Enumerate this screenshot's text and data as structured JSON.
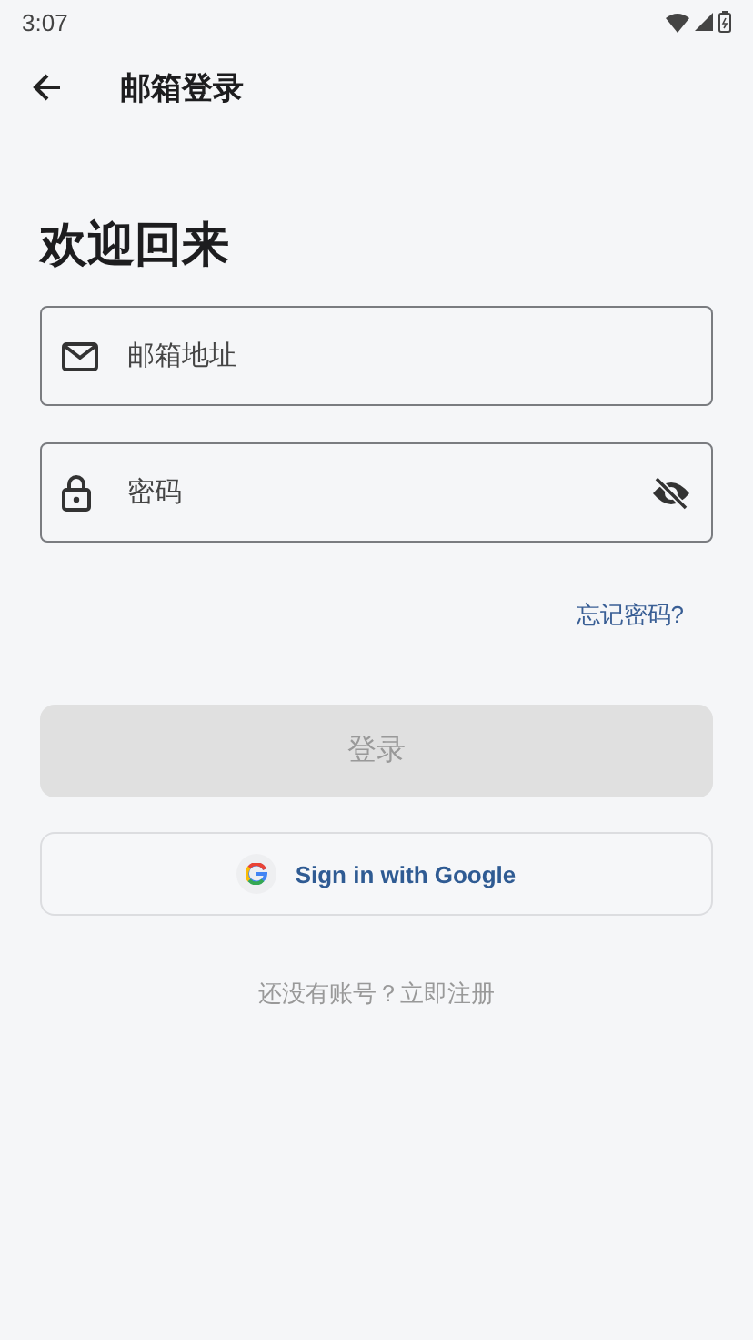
{
  "status_bar": {
    "time": "3:07"
  },
  "app_bar": {
    "title": "邮箱登录"
  },
  "heading": "欢迎回来",
  "fields": [
    {
      "kind": "email",
      "placeholder": "邮箱地址"
    },
    {
      "kind": "password",
      "placeholder": "密码"
    }
  ],
  "forgot_password": "忘记密码?",
  "login_button": {
    "label": "登录",
    "disabled": true
  },
  "google_button": {
    "label": "Sign in with Google"
  },
  "register_prompt": "还没有账号？立即注册"
}
